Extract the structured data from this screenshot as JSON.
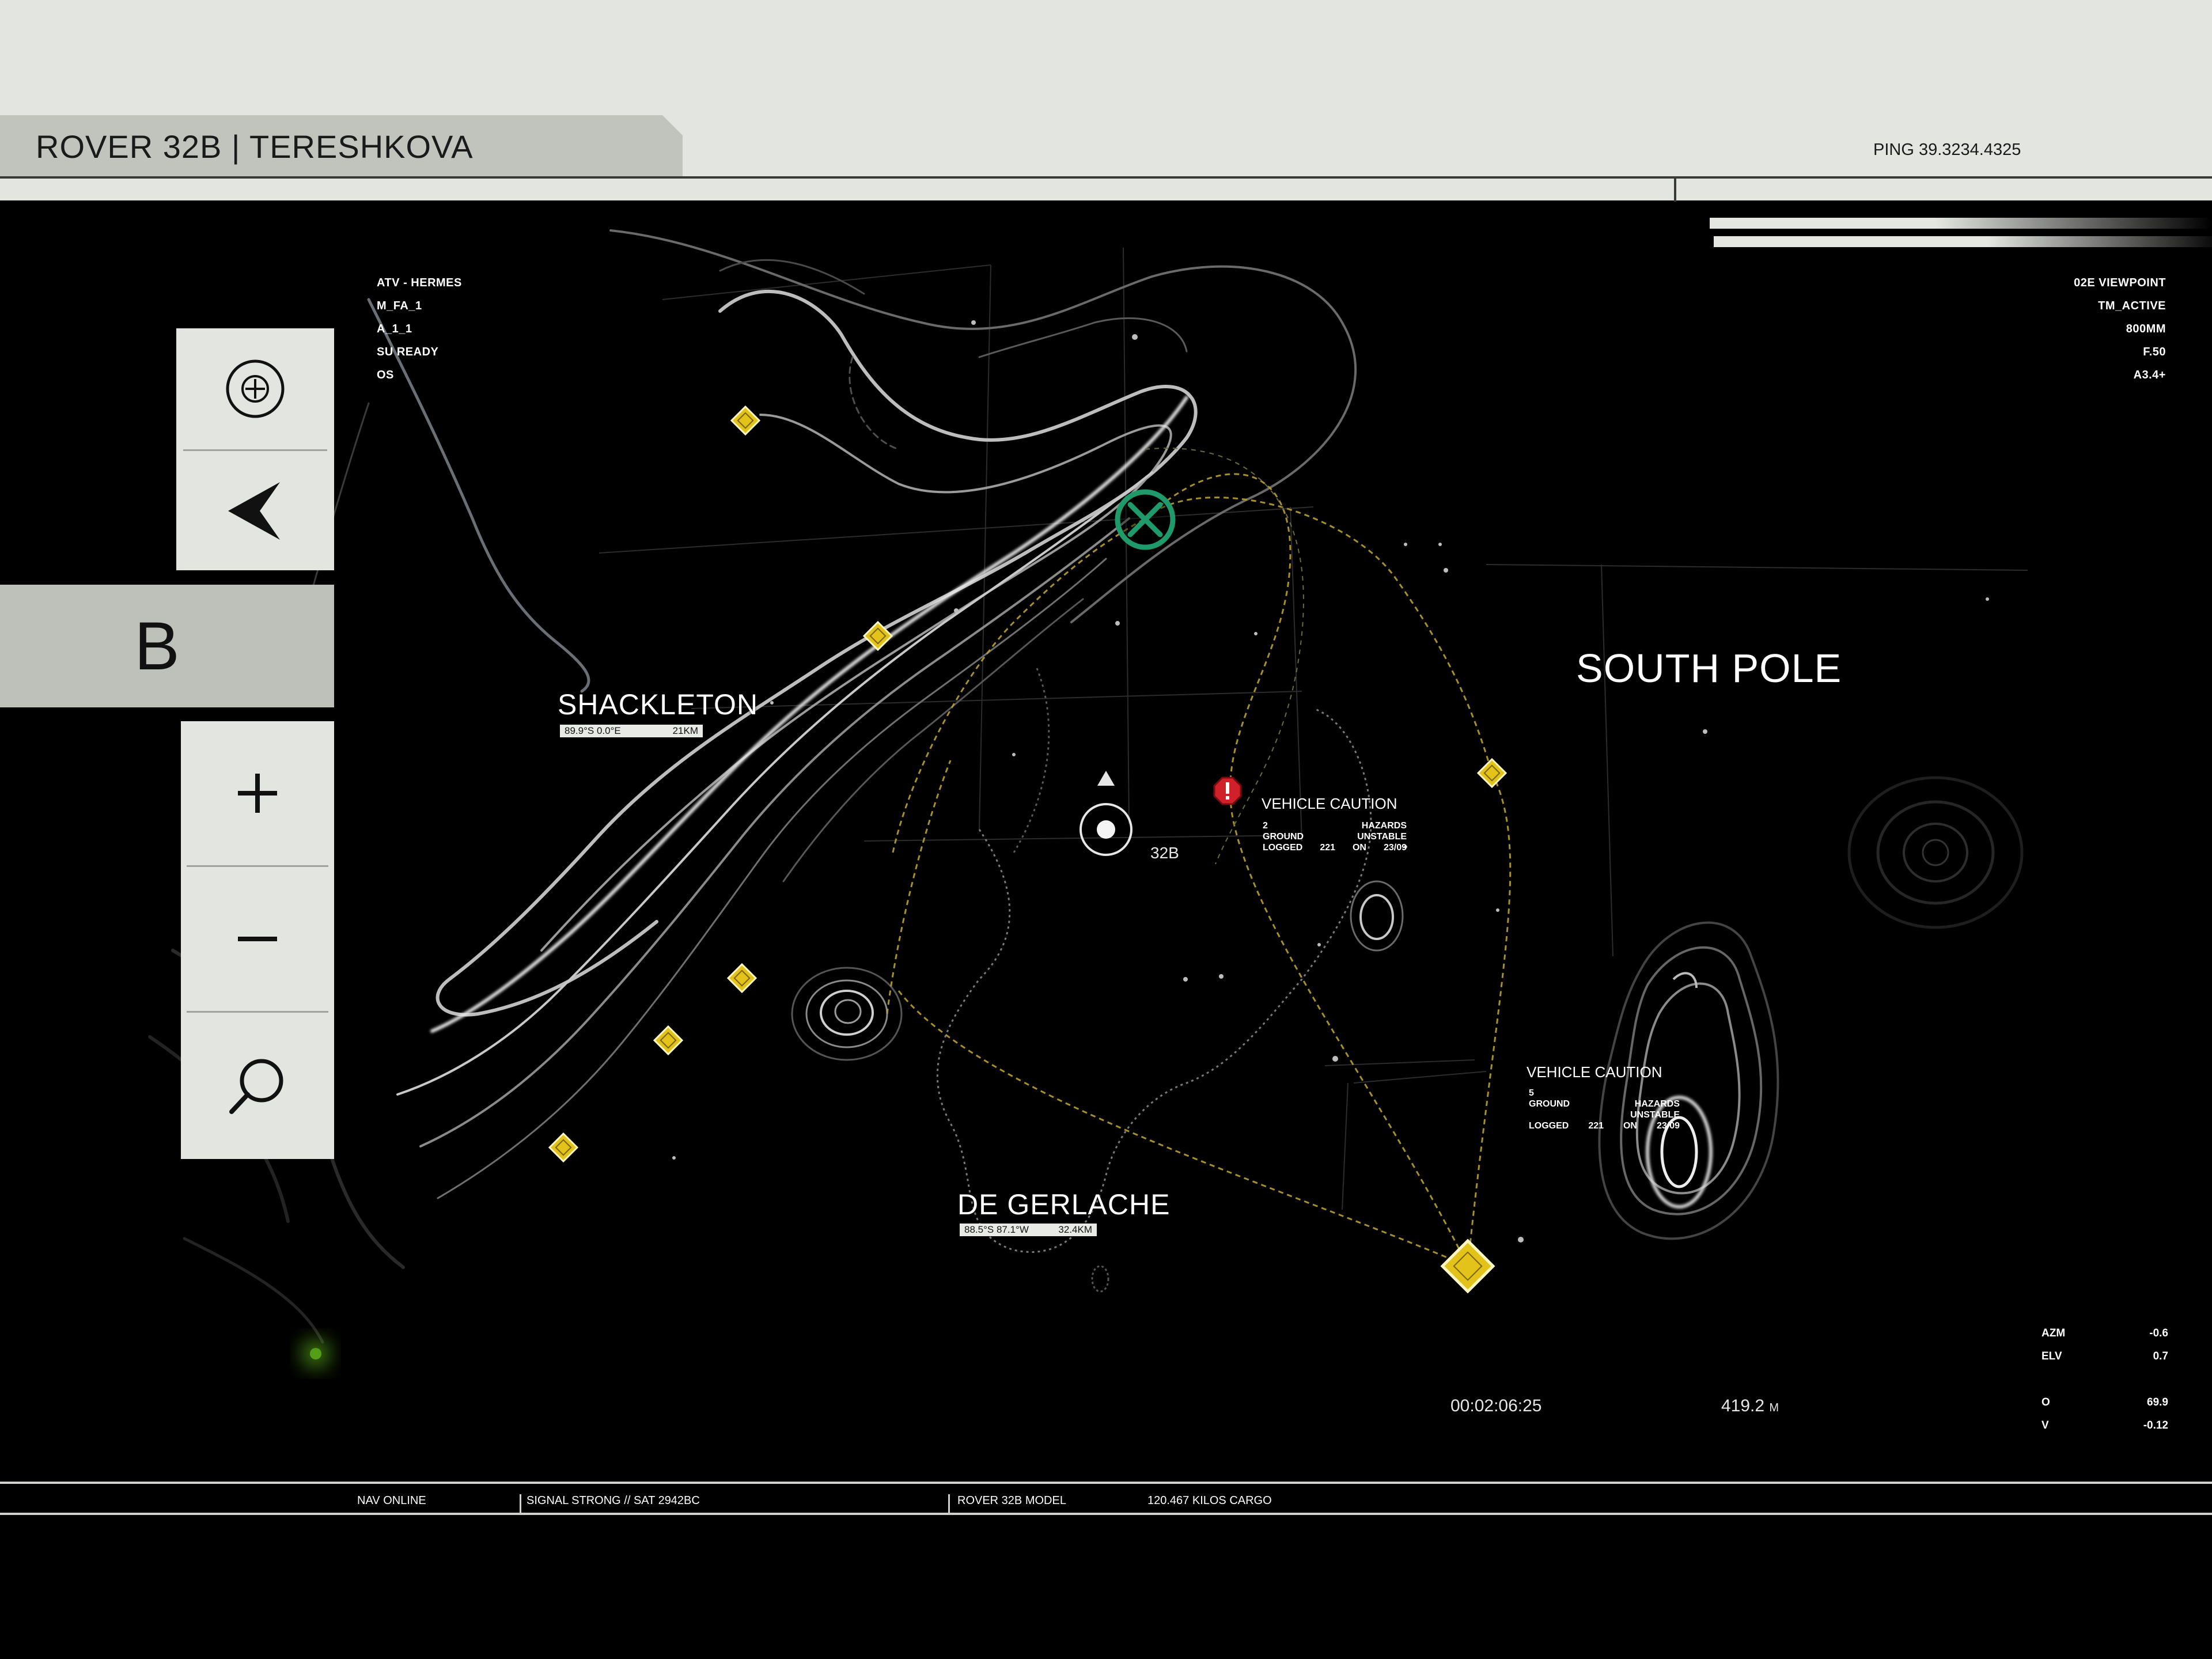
{
  "header": {
    "title": "ROVER 32B | TERESHKOVA",
    "ping": "PING 39.3234.4325"
  },
  "left_panel": {
    "target_icon": "crosshair-circle-icon",
    "back_icon": "chevron-left-icon",
    "mode_letter": "B",
    "zoom_in_icon": "plus-icon",
    "zoom_out_icon": "minus-icon",
    "search_icon": "magnifier-icon"
  },
  "status_left": [
    "ATV - HERMES",
    "M_FA_1",
    "A_1_1",
    "SU READY",
    "OS"
  ],
  "status_right": [
    "02E VIEWPOINT",
    "TM_ACTIVE",
    "800MM",
    "F.50",
    "A3.4+"
  ],
  "places": {
    "shackleton": {
      "name": "SHACKLETON",
      "coord": "89.9°S 0.0°E",
      "dist": "21KM"
    },
    "de_gerlache": {
      "name": "DE GERLACHE",
      "coord": "88.5°S 87.1°W",
      "dist": "32.4KM"
    },
    "south_pole": {
      "name": "SOUTH POLE"
    }
  },
  "rover": {
    "label": "32B"
  },
  "cautions": [
    {
      "title": "VEHICLE CAUTION",
      "rows": [
        [
          "2",
          "HAZARDS"
        ],
        [
          "GROUND",
          "UNSTABLE"
        ],
        [
          "LOGGED",
          "221",
          "ON",
          "23/09"
        ]
      ]
    },
    {
      "title": "VEHICLE CAUTION",
      "rows": [
        [
          "5",
          ""
        ],
        [
          "GROUND",
          "HAZARDS"
        ],
        [
          "",
          "UNSTABLE"
        ],
        [
          "LOGGED",
          "221",
          "ON",
          "23/09"
        ]
      ]
    }
  ],
  "readouts": {
    "time": "00:02:06:25",
    "distance": "419.2",
    "distance_unit": "M"
  },
  "telemetry": [
    {
      "label": "AZM",
      "value": "-0.6"
    },
    {
      "label": "ELV",
      "value": "0.7"
    },
    {
      "label": "O",
      "value": "69.9"
    },
    {
      "label": "V",
      "value": "-0.12"
    }
  ],
  "footer": {
    "nav": "NAV ONLINE",
    "signal": "SIGNAL STRONG // SAT 2942BC",
    "model": "ROVER 32B MODEL",
    "cargo": "120.467 KILOS CARGO"
  },
  "colors": {
    "header_bg": "#e2e5e0",
    "tab_bg": "#c0c4bd",
    "waypoint": "#e3c21a",
    "target": "#1f9a6a",
    "caution": "#d0202a"
  }
}
